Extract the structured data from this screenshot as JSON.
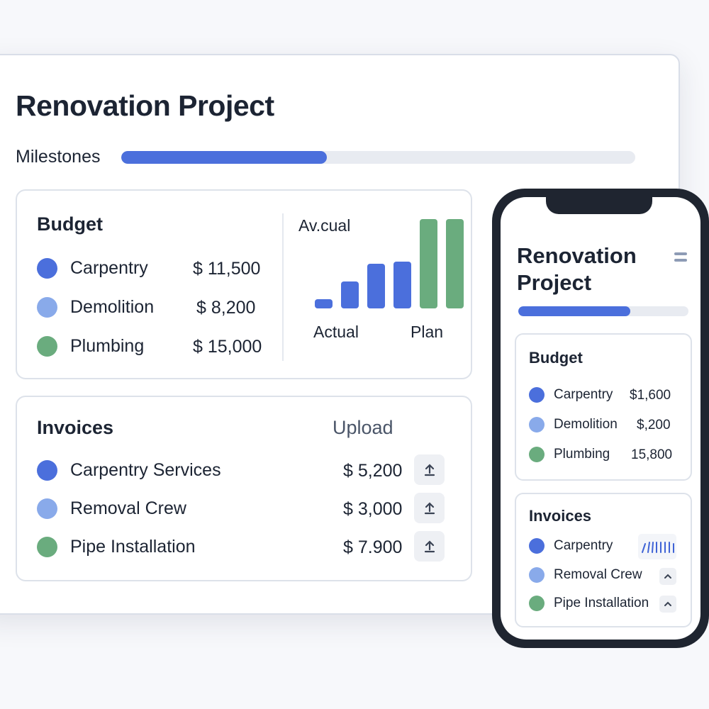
{
  "colors": {
    "accent": "#4b6fdc",
    "carpentry": "#4b6fdc",
    "demolition": "#89aaea",
    "plumbing": "#6aac7e",
    "track": "#e8ebf1"
  },
  "desktop": {
    "title": "Renovation Project",
    "milestones": {
      "label": "Milestones",
      "progress": 0.4
    },
    "budget": {
      "title": "Budget",
      "items": [
        {
          "label": "Carpentry",
          "amount": "$ 11,500",
          "color": "#4b6fdc"
        },
        {
          "label": "Demolition",
          "amount": "$ 8,200",
          "color": "#89aaea"
        },
        {
          "label": "Plumbing",
          "amount": "$ 15,000",
          "color": "#6aac7e"
        }
      ]
    },
    "chart": {
      "title": "Av.cual",
      "actual_label": "Actual",
      "plan_label": "Plan"
    },
    "invoices": {
      "title": "Invoices",
      "upload_label": "Upload",
      "items": [
        {
          "label": "Carpentry Services",
          "amount": "$ 5,200",
          "color": "#4b6fdc",
          "icon": "upload-icon"
        },
        {
          "label": "Removal Crew",
          "amount": "$ 3,000",
          "color": "#89aaea",
          "icon": "upload-icon"
        },
        {
          "label": "Pipe Installation",
          "amount": "$ 7.900",
          "color": "#6aac7e",
          "icon": "upload-icon"
        }
      ]
    }
  },
  "chart_data": {
    "type": "bar",
    "title": "Av.cual",
    "xlabel": "",
    "ylabel": "",
    "categories": [
      "Actual",
      "",
      "",
      "",
      "Plan",
      ""
    ],
    "values": [
      1,
      3,
      5,
      5.2,
      10,
      10
    ],
    "colors": [
      "#4b6fdc",
      "#4b6fdc",
      "#4b6fdc",
      "#4b6fdc",
      "#6aac7e",
      "#6aac7e"
    ],
    "ylim": [
      0,
      10
    ],
    "grid": false
  },
  "mobile": {
    "title_line1": "Renovation",
    "title_line2": "Project",
    "menu_icon": "hamburger-icon",
    "progress": 0.66,
    "budget": {
      "title": "Budget",
      "items": [
        {
          "label": "Carpentry",
          "amount": "$1,600",
          "color": "#4b6fdc"
        },
        {
          "label": "Demolition",
          "amount": "$,200",
          "color": "#89aaea"
        },
        {
          "label": "Plumbing",
          "amount": "15,800",
          "color": "#6aac7e"
        }
      ]
    },
    "invoices": {
      "title": "Invoices",
      "items": [
        {
          "label": "Carpentry",
          "color": "#4b6fdc",
          "icon": "mini-bars-icon"
        },
        {
          "label": "Removal Crew",
          "color": "#89aaea",
          "icon": "chevron-up-icon"
        },
        {
          "label": "Pipe Installation",
          "color": "#6aac7e",
          "icon": "chevron-up-icon"
        }
      ]
    }
  }
}
